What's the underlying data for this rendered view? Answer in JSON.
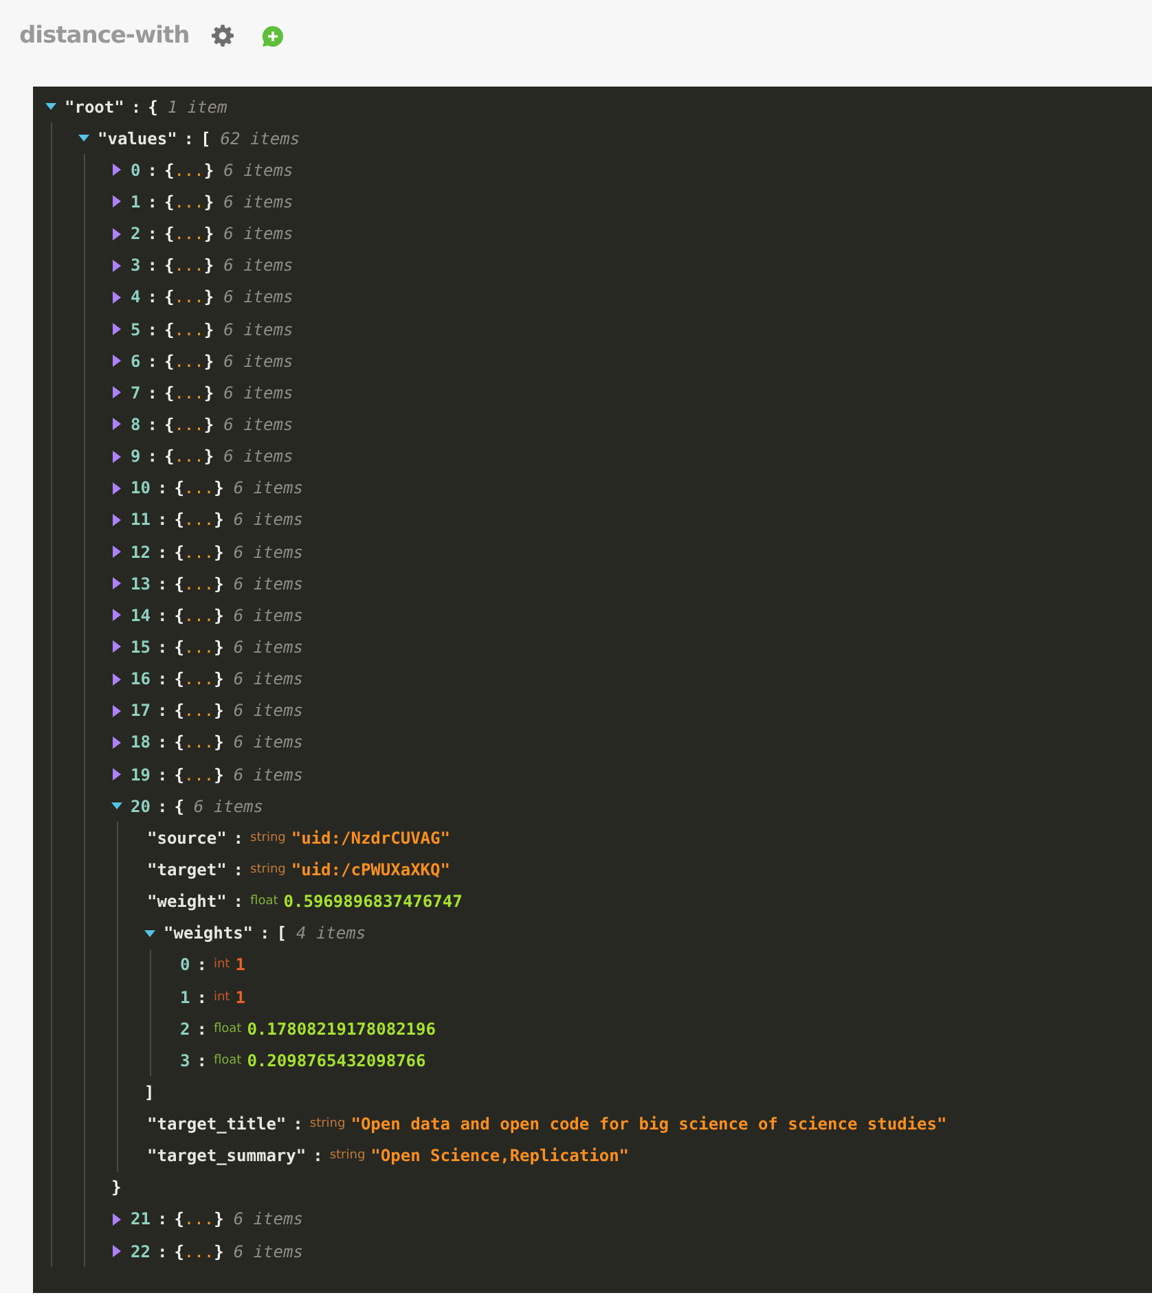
{
  "header": {
    "title": "distance-with"
  },
  "tree": {
    "key": "\"root\"",
    "colon": ":",
    "kind": "object",
    "expanded": true,
    "open": "{",
    "count": "1 item",
    "children": [
      {
        "key": "\"values\"",
        "colon": ":",
        "kind": "array",
        "expanded": true,
        "open": "[",
        "count": "62 items",
        "children": [
          {
            "key": "0",
            "colon": ":",
            "kind": "object",
            "expanded": false,
            "preview": [
              "{",
              "...",
              "}"
            ],
            "count": "6 items"
          },
          {
            "key": "1",
            "colon": ":",
            "kind": "object",
            "expanded": false,
            "preview": [
              "{",
              "...",
              "}"
            ],
            "count": "6 items"
          },
          {
            "key": "2",
            "colon": ":",
            "kind": "object",
            "expanded": false,
            "preview": [
              "{",
              "...",
              "}"
            ],
            "count": "6 items"
          },
          {
            "key": "3",
            "colon": ":",
            "kind": "object",
            "expanded": false,
            "preview": [
              "{",
              "...",
              "}"
            ],
            "count": "6 items"
          },
          {
            "key": "4",
            "colon": ":",
            "kind": "object",
            "expanded": false,
            "preview": [
              "{",
              "...",
              "}"
            ],
            "count": "6 items"
          },
          {
            "key": "5",
            "colon": ":",
            "kind": "object",
            "expanded": false,
            "preview": [
              "{",
              "...",
              "}"
            ],
            "count": "6 items"
          },
          {
            "key": "6",
            "colon": ":",
            "kind": "object",
            "expanded": false,
            "preview": [
              "{",
              "...",
              "}"
            ],
            "count": "6 items"
          },
          {
            "key": "7",
            "colon": ":",
            "kind": "object",
            "expanded": false,
            "preview": [
              "{",
              "...",
              "}"
            ],
            "count": "6 items"
          },
          {
            "key": "8",
            "colon": ":",
            "kind": "object",
            "expanded": false,
            "preview": [
              "{",
              "...",
              "}"
            ],
            "count": "6 items"
          },
          {
            "key": "9",
            "colon": ":",
            "kind": "object",
            "expanded": false,
            "preview": [
              "{",
              "...",
              "}"
            ],
            "count": "6 items"
          },
          {
            "key": "10",
            "colon": ":",
            "kind": "object",
            "expanded": false,
            "preview": [
              "{",
              "...",
              "}"
            ],
            "count": "6 items"
          },
          {
            "key": "11",
            "colon": ":",
            "kind": "object",
            "expanded": false,
            "preview": [
              "{",
              "...",
              "}"
            ],
            "count": "6 items"
          },
          {
            "key": "12",
            "colon": ":",
            "kind": "object",
            "expanded": false,
            "preview": [
              "{",
              "...",
              "}"
            ],
            "count": "6 items"
          },
          {
            "key": "13",
            "colon": ":",
            "kind": "object",
            "expanded": false,
            "preview": [
              "{",
              "...",
              "}"
            ],
            "count": "6 items"
          },
          {
            "key": "14",
            "colon": ":",
            "kind": "object",
            "expanded": false,
            "preview": [
              "{",
              "...",
              "}"
            ],
            "count": "6 items"
          },
          {
            "key": "15",
            "colon": ":",
            "kind": "object",
            "expanded": false,
            "preview": [
              "{",
              "...",
              "}"
            ],
            "count": "6 items"
          },
          {
            "key": "16",
            "colon": ":",
            "kind": "object",
            "expanded": false,
            "preview": [
              "{",
              "...",
              "}"
            ],
            "count": "6 items"
          },
          {
            "key": "17",
            "colon": ":",
            "kind": "object",
            "expanded": false,
            "preview": [
              "{",
              "...",
              "}"
            ],
            "count": "6 items"
          },
          {
            "key": "18",
            "colon": ":",
            "kind": "object",
            "expanded": false,
            "preview": [
              "{",
              "...",
              "}"
            ],
            "count": "6 items"
          },
          {
            "key": "19",
            "colon": ":",
            "kind": "object",
            "expanded": false,
            "preview": [
              "{",
              "...",
              "}"
            ],
            "count": "6 items"
          },
          {
            "key": "20",
            "colon": ":",
            "kind": "object",
            "expanded": true,
            "open": "{",
            "count": "6 items",
            "close": "}",
            "children": [
              {
                "key": "\"source\"",
                "colon": ":",
                "kind": "string",
                "type": "string",
                "value": "\"uid:/NzdrCUVAG\""
              },
              {
                "key": "\"target\"",
                "colon": ":",
                "kind": "string",
                "type": "string",
                "value": "\"uid:/cPWUXaXKQ\""
              },
              {
                "key": "\"weight\"",
                "colon": ":",
                "kind": "float",
                "type": "float",
                "value": "0.5969896837476747"
              },
              {
                "key": "\"weights\"",
                "colon": ":",
                "kind": "array",
                "expanded": true,
                "open": "[",
                "count": "4 items",
                "close": "]",
                "children": [
                  {
                    "key": "0",
                    "colon": ":",
                    "kind": "int",
                    "type": "int",
                    "value": "1"
                  },
                  {
                    "key": "1",
                    "colon": ":",
                    "kind": "int",
                    "type": "int",
                    "value": "1"
                  },
                  {
                    "key": "2",
                    "colon": ":",
                    "kind": "float",
                    "type": "float",
                    "value": "0.17808219178082196"
                  },
                  {
                    "key": "3",
                    "colon": ":",
                    "kind": "float",
                    "type": "float",
                    "value": "0.2098765432098766"
                  }
                ]
              },
              {
                "key": "\"target_title\"",
                "colon": ":",
                "kind": "string",
                "type": "string",
                "value": "\"Open data and open code for big science of science studies\""
              },
              {
                "key": "\"target_summary\"",
                "colon": ":",
                "kind": "string",
                "type": "string",
                "value": "\"Open Science,Replication\""
              }
            ]
          },
          {
            "key": "21",
            "colon": ":",
            "kind": "object",
            "expanded": false,
            "preview": [
              "{",
              "...",
              "}"
            ],
            "count": "6 items"
          },
          {
            "key": "22",
            "colon": ":",
            "kind": "object",
            "expanded": false,
            "preview": [
              "{",
              "...",
              "}"
            ],
            "count": "6 items"
          }
        ]
      }
    ]
  }
}
